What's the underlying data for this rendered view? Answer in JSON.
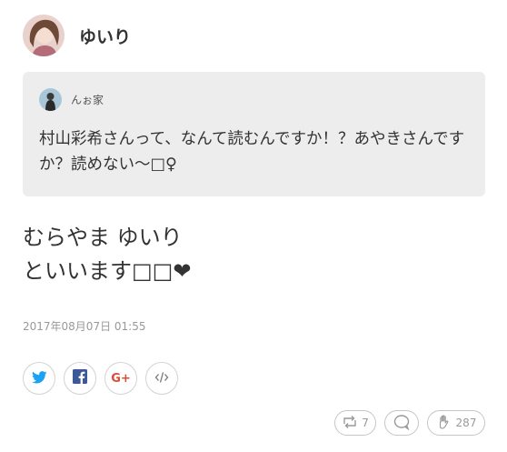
{
  "post": {
    "author_name": "ゆいり",
    "quote": {
      "author_name": "んぉ家",
      "text": "村山彩希さんって、なんて読むんですか！？あやきさんですか？読めない〜□♀"
    },
    "body_lines": [
      "むらやま ゆいり",
      "といいます□□❤"
    ],
    "timestamp": "2017年08月07日 01:55"
  },
  "share": {
    "icons": [
      "twitter-icon",
      "facebook-icon",
      "google-plus-icon",
      "embed-code-icon"
    ],
    "google_plus_label": "G+"
  },
  "actions": {
    "retweet_count": "7",
    "like_count": "287"
  },
  "colors": {
    "twitter": "#1da1f2",
    "facebook": "#3b5998",
    "google_plus": "#dd4b39",
    "quote_bg": "#ededed"
  }
}
